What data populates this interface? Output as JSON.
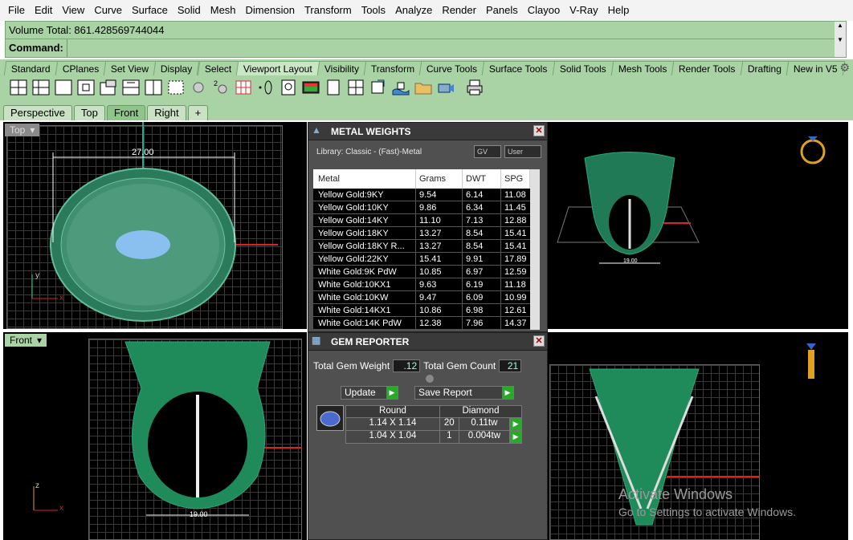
{
  "menu": [
    "File",
    "Edit",
    "View",
    "Curve",
    "Surface",
    "Solid",
    "Mesh",
    "Dimension",
    "Transform",
    "Tools",
    "Analyze",
    "Render",
    "Panels",
    "Clayoo",
    "V-Ray",
    "Help"
  ],
  "command": {
    "history": "Volume Total: 861.428569744044",
    "label": "Command:",
    "value": ""
  },
  "toolbar_tabs": [
    "Standard",
    "CPlanes",
    "Set View",
    "Display",
    "Select",
    "Viewport Layout",
    "Visibility",
    "Transform",
    "Curve Tools",
    "Surface Tools",
    "Solid Tools",
    "Mesh Tools",
    "Render Tools",
    "Drafting",
    "New in V5"
  ],
  "toolbar_active": "Viewport Layout",
  "viewport_tabs": [
    "Perspective",
    "Top",
    "Front",
    "Right"
  ],
  "viewport_add": "+",
  "viewports": {
    "top": {
      "label": "Top",
      "dim": "27.00",
      "axis_y": "y",
      "axis_x": "x"
    },
    "front": {
      "label": "Front",
      "dim": "19.00",
      "axis_z": "z",
      "axis_x": "x"
    },
    "persp_dim": "19.00"
  },
  "metal_weights": {
    "title": "METAL WEIGHTS",
    "library": "Library: Classic - (Fast)-Metal",
    "gv": "GV",
    "user": "User",
    "columns": [
      "Metal",
      "Grams",
      "DWT",
      "SPG"
    ],
    "rows": [
      [
        "Yellow Gold:9KY",
        "9.54",
        "6.14",
        "11.08"
      ],
      [
        "Yellow Gold:10KY",
        "9.86",
        "6.34",
        "11.45"
      ],
      [
        "Yellow Gold:14KY",
        "11.10",
        "7.13",
        "12.88"
      ],
      [
        "Yellow Gold:18KY",
        "13.27",
        "8.54",
        "15.41"
      ],
      [
        "Yellow Gold:18KY R...",
        "13.27",
        "8.54",
        "15.41"
      ],
      [
        "Yellow Gold:22KY",
        "15.41",
        "9.91",
        "17.89"
      ],
      [
        "White Gold:9K PdW",
        "10.85",
        "6.97",
        "12.59"
      ],
      [
        "White Gold:10KX1",
        "9.63",
        "6.19",
        "11.18"
      ],
      [
        "White Gold:10KW",
        "9.47",
        "6.09",
        "10.99"
      ],
      [
        "White Gold:14KX1",
        "10.86",
        "6.98",
        "12.61"
      ],
      [
        "White Gold:14K PdW",
        "12.38",
        "7.96",
        "14.37"
      ]
    ]
  },
  "gem_reporter": {
    "title": "GEM REPORTER",
    "weight_label": "Total Gem Weight",
    "weight": ".12",
    "count_label": "Total Gem Count",
    "count": "21",
    "update": "Update",
    "save": "Save Report",
    "columns": [
      "Round",
      "Diamond"
    ],
    "rows": [
      [
        "1.14 X 1.14",
        "20",
        "0.11tw"
      ],
      [
        "1.04 X 1.04",
        "1",
        "0.004tw"
      ]
    ]
  },
  "watermark": {
    "line1": "Activate Windows",
    "line2": "Go to Settings to activate Windows."
  },
  "colors": {
    "accent": "#a9d2a5",
    "ring": "#1f8a5a",
    "viewport_bg": "#000000"
  }
}
